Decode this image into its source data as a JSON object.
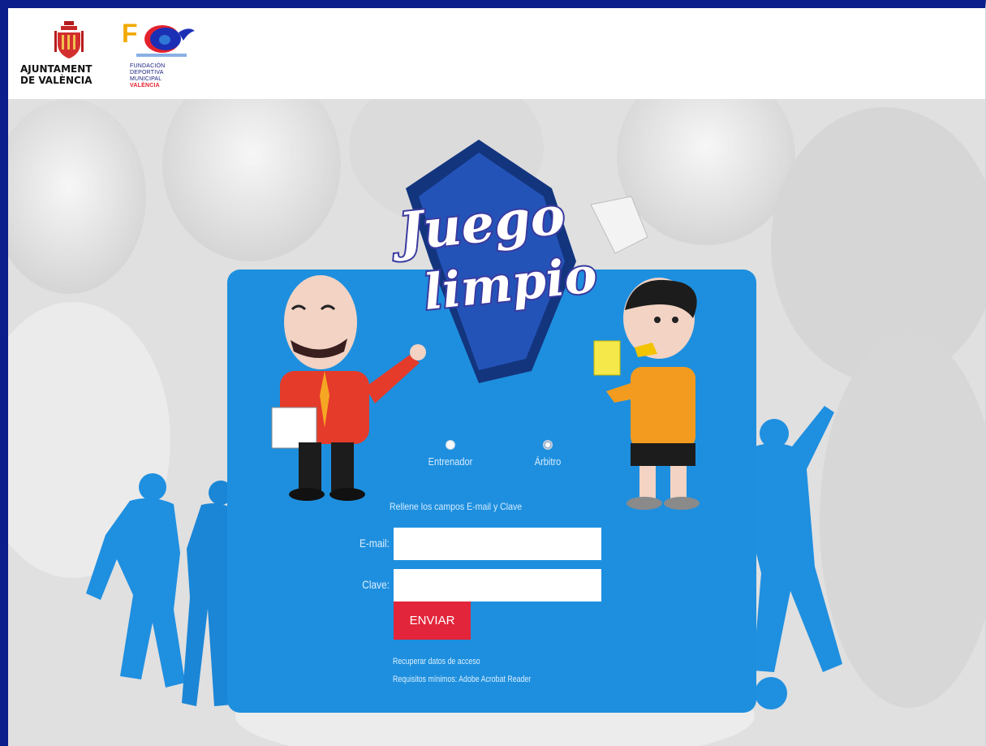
{
  "header": {
    "city_logo_line1": "AJUNTAMENT",
    "city_logo_line2": "DE VALÈNCIA",
    "fdm_logo_line1": "FUNDACIÓN",
    "fdm_logo_line2": "DEPORTIVA",
    "fdm_logo_line3": "MUNICIPAL",
    "fdm_logo_line4": "VALÈNCIA"
  },
  "brand": {
    "title_line1": "Juego",
    "title_line2": "limpio"
  },
  "roles": [
    {
      "label": "Entrenador",
      "selected": false
    },
    {
      "label": "Árbitro",
      "selected": true
    }
  ],
  "form": {
    "hint": "Rellene los campos E-mail y Clave",
    "email_label": "E-mail:",
    "email_value": "",
    "password_label": "Clave:",
    "password_value": "",
    "submit_label": "ENVIAR",
    "recover_link": "Recuperar datos de acceso",
    "requirements_link": "Requisitos mínimos: Adobe Acrobat Reader"
  },
  "colors": {
    "frame": "#0b1e8c",
    "panel": "#1e8fde",
    "submit": "#e2253a",
    "shield": "#1d3c9e"
  }
}
